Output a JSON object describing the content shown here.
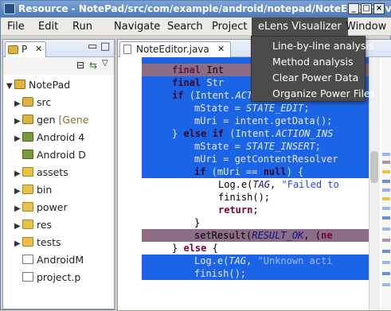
{
  "window": {
    "title": "Resource - NotePad/src/com/example/android/notepad/NoteEditor.java"
  },
  "menubar": {
    "items": [
      "File",
      "Edit",
      "Run",
      "Navigate",
      "Search",
      "Project",
      "eLens Visualizer",
      "Window"
    ]
  },
  "dropdown": {
    "items": [
      "Line-by-line analysis",
      "Method analysis",
      "Clear Power Data",
      "Organize Power Files"
    ]
  },
  "package_explorer": {
    "tab_label": "P",
    "tree": [
      {
        "label": "NotePad",
        "icon": "project-icon"
      },
      {
        "label": "src",
        "icon": "package-folder-icon"
      },
      {
        "label": "gen",
        "suffix": "[Gene",
        "icon": "package-folder-icon"
      },
      {
        "label": "Android 4",
        "icon": "library-icon"
      },
      {
        "label": "Android D",
        "icon": "library-icon"
      },
      {
        "label": "assets",
        "icon": "folder-icon"
      },
      {
        "label": "bin",
        "icon": "folder-icon"
      },
      {
        "label": "power",
        "icon": "folder-icon"
      },
      {
        "label": "res",
        "icon": "folder-icon"
      },
      {
        "label": "tests",
        "icon": "folder-icon"
      },
      {
        "label": "AndroidM",
        "icon": "file-icon"
      },
      {
        "label": "project.p",
        "icon": "file-icon"
      }
    ]
  },
  "editor": {
    "tab_label": "NoteEditor.java",
    "lines": [
      {
        "t": "final Int"
      },
      {
        "t": "final Str"
      },
      {
        "t": "if (Intent.ACTION_EDIT.equal"
      },
      {
        "t": "mState = STATE_EDIT;"
      },
      {
        "t": "mUri = intent.getData();"
      },
      {
        "t": "} else if (Intent.ACTION_INS"
      },
      {
        "t": "mState = STATE_INSERT;"
      },
      {
        "t": "mUri = getContentResolver"
      },
      {
        "t": "if (mUri == null) {"
      },
      {
        "t": "Log.e(TAG, \"Failed to"
      },
      {
        "t": "finish();"
      },
      {
        "t": "return;"
      },
      {
        "t": "}"
      },
      {
        "t": "setResult(RESULT_OK, (ne"
      },
      {
        "t": "} else {"
      },
      {
        "t": "Log.e(TAG, \"Unknown acti"
      },
      {
        "t": "finish();"
      }
    ]
  },
  "colors": {
    "menu_open_bg": "#4b4b4b",
    "highlight_blue": "#1b64e6",
    "highlight_mauve": "#8b6d86",
    "highlight_navy": "#2a4e9a",
    "title_bar": "#4f79b4"
  }
}
